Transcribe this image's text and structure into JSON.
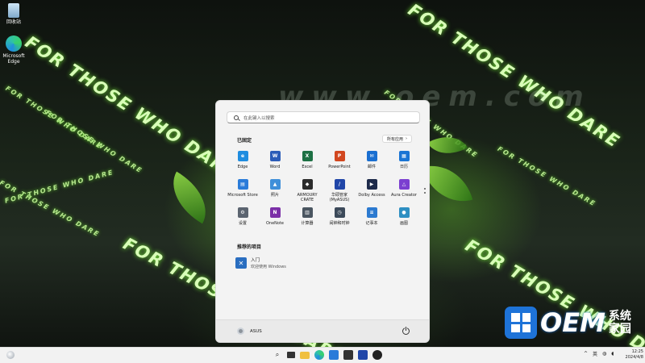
{
  "desktop": {
    "icons": [
      {
        "label": "回收站"
      },
      {
        "label": "Microsoft\nEdge"
      }
    ],
    "wallpaper_text": "FOR THOSE WHO DARE",
    "watermark": "www.oem.com",
    "oem_logo": {
      "text": "OEM",
      "sub1": "系统",
      "sub2": "家园"
    }
  },
  "start_menu": {
    "search_placeholder": "在此键入以搜索",
    "pinned_title": "已固定",
    "all_apps_label": "所有应用",
    "pinned_apps": [
      {
        "label": "Edge",
        "icon": "edge-icon",
        "color": "#1f8de0"
      },
      {
        "label": "Word",
        "icon": "word-icon",
        "color": "#2b5cb8"
      },
      {
        "label": "Excel",
        "icon": "excel-icon",
        "color": "#1d7044"
      },
      {
        "label": "PowerPoint",
        "icon": "powerpoint-icon",
        "color": "#d2471f"
      },
      {
        "label": "邮件",
        "icon": "mail-icon",
        "color": "#1a6fd1"
      },
      {
        "label": "日历",
        "icon": "calendar-icon",
        "color": "#1a74d4"
      },
      {
        "label": "Microsoft Store",
        "icon": "store-icon",
        "color": "#2a7bd9"
      },
      {
        "label": "照片",
        "icon": "photos-icon",
        "color": "#3f8fd9"
      },
      {
        "label": "ARMOURY CRATE",
        "icon": "armoury-crate-icon",
        "color": "#2b2b2b"
      },
      {
        "label": "华硕管家 (MyASUS)",
        "icon": "myasus-icon",
        "color": "#2046a8"
      },
      {
        "label": "Dolby Access",
        "icon": "dolby-icon",
        "color": "#1d2a4a"
      },
      {
        "label": "Aura Creator",
        "icon": "aura-creator-icon",
        "color": "#7b3fd0"
      },
      {
        "label": "设置",
        "icon": "settings-icon",
        "color": "#5b6470"
      },
      {
        "label": "OneNote",
        "icon": "onenote-icon",
        "color": "#7b2fa7"
      },
      {
        "label": "计算器",
        "icon": "calculator-icon",
        "color": "#4a5560"
      },
      {
        "label": "闹钟和时钟",
        "icon": "clock-icon",
        "color": "#3c4a5a"
      },
      {
        "label": "记事本",
        "icon": "notepad-icon",
        "color": "#2c7ad0"
      },
      {
        "label": "画图",
        "icon": "paint-icon",
        "color": "#2e8fc2"
      }
    ],
    "recommended_title": "推荐的项目",
    "recommended": [
      {
        "title": "入门",
        "subtitle": "欢迎使用 Windows"
      }
    ],
    "user_name": "ASUS"
  },
  "taskbar": {
    "tray_ime": "英",
    "clock_time": "12:25",
    "clock_date": "2024/4/8"
  }
}
